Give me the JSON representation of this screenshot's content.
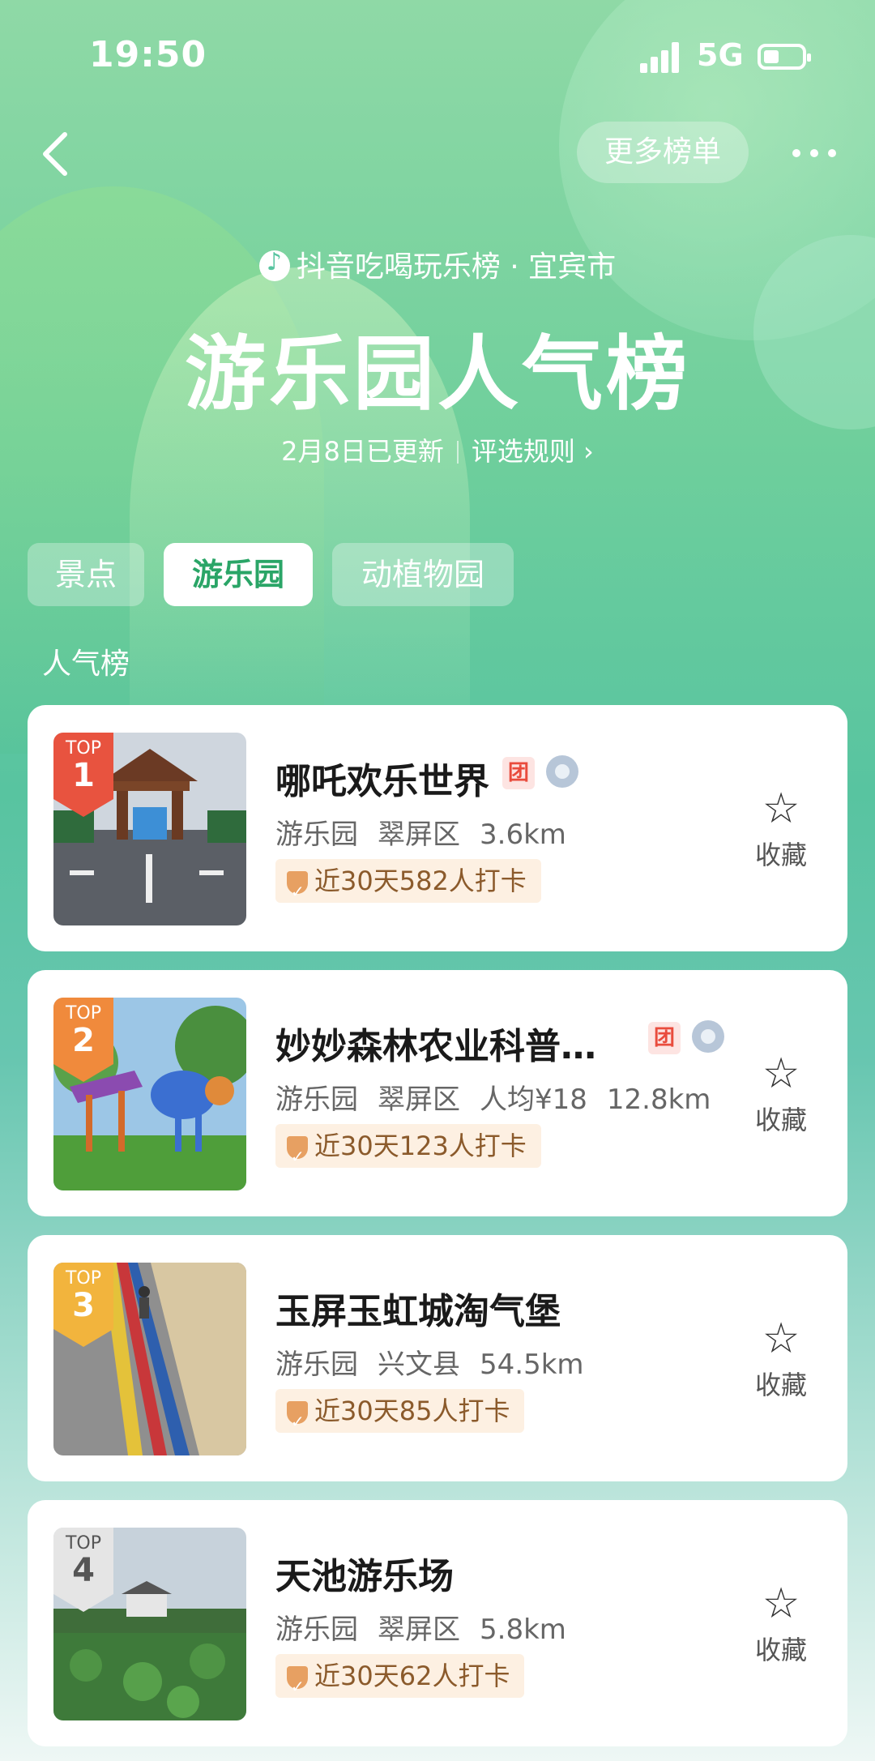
{
  "status_bar": {
    "time": "19:50",
    "network": "5G"
  },
  "nav": {
    "more_lists": "更多榜单"
  },
  "header": {
    "brand": "抖音吃喝玩乐榜 · 宜宾市",
    "title": "游乐园人气榜",
    "updated": "2月8日已更新",
    "rules": "评选规则 ›"
  },
  "tabs": [
    {
      "label": "景点",
      "active": false
    },
    {
      "label": "游乐园",
      "active": true
    },
    {
      "label": "动植物园",
      "active": false
    }
  ],
  "section_label": "人气榜",
  "items": [
    {
      "rank_prefix": "TOP",
      "rank": "1",
      "badge_color": "#e8533f",
      "name": "哪吒欢乐世界",
      "has_tuan": true,
      "tuan": "团",
      "category": "游乐园",
      "district": "翠屏区",
      "price": "",
      "distance": "3.6km",
      "checkin": "近30天582人打卡",
      "fav": "收藏"
    },
    {
      "rank_prefix": "TOP",
      "rank": "2",
      "badge_color": "#f08a3c",
      "name": "妙妙森林农业科普…",
      "has_tuan": true,
      "tuan": "团",
      "category": "游乐园",
      "district": "翠屏区",
      "price": "人均¥18",
      "distance": "12.8km",
      "checkin": "近30天123人打卡",
      "fav": "收藏"
    },
    {
      "rank_prefix": "TOP",
      "rank": "3",
      "badge_color": "#f2b43d",
      "name": "玉屏玉虹城淘气堡",
      "has_tuan": false,
      "tuan": "",
      "category": "游乐园",
      "district": "兴文县",
      "price": "",
      "distance": "54.5km",
      "checkin": "近30天85人打卡",
      "fav": "收藏"
    },
    {
      "rank_prefix": "TOP",
      "rank": "4",
      "badge_color": "#e5e5e5",
      "name": "天池游乐场",
      "has_tuan": false,
      "tuan": "",
      "category": "游乐园",
      "district": "翠屏区",
      "price": "",
      "distance": "5.8km",
      "checkin": "近30天62人打卡",
      "fav": "收藏"
    }
  ]
}
